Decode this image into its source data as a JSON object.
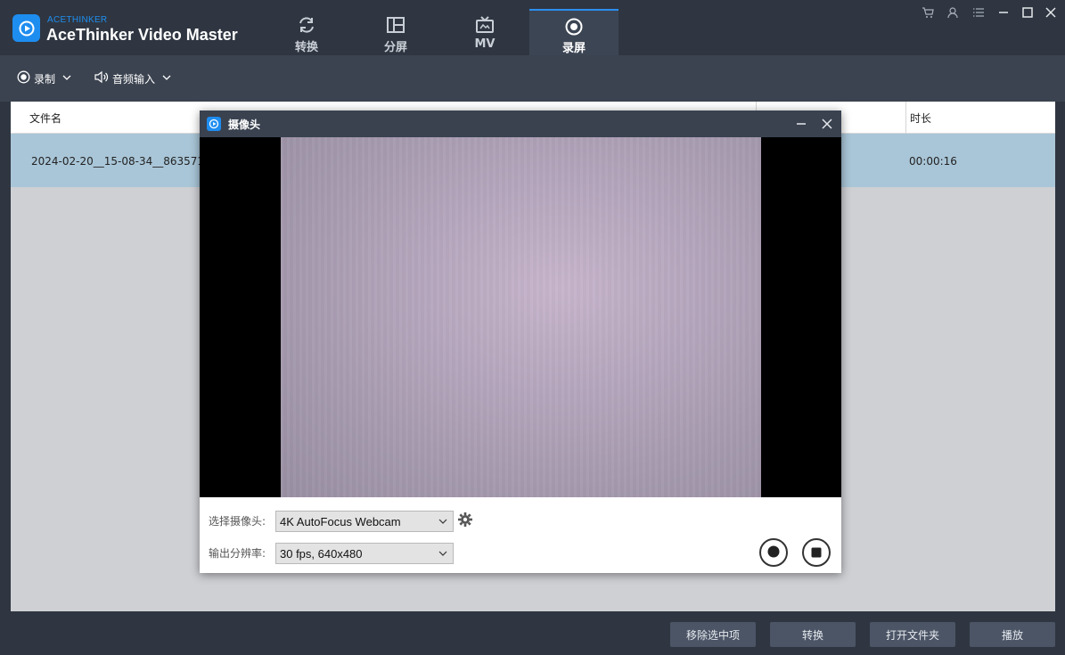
{
  "app": {
    "brand_small": "ACETHINKER",
    "brand_name": "AceThinker Video Master"
  },
  "tabs": [
    {
      "label": "转换",
      "icon": "refresh-icon"
    },
    {
      "label": "分屏",
      "icon": "split-screen-icon"
    },
    {
      "label": "MV",
      "icon": "tv-icon"
    },
    {
      "label": "录屏",
      "icon": "record-icon",
      "active": true
    }
  ],
  "window_controls": [
    "cart-icon",
    "user-icon",
    "menu-icon",
    "minimize-icon",
    "maximize-icon",
    "close-icon"
  ],
  "toolbar": {
    "record_label": "录制",
    "audio_label": "音频输入"
  },
  "table": {
    "columns": [
      "文件名",
      "时长"
    ],
    "rows": [
      {
        "filename": "2024-02-20__15-08-34__8635715",
        "duration": "00:00:16"
      }
    ]
  },
  "bottom": {
    "remove_label": "移除选中项",
    "convert_label": "转换",
    "open_folder_label": "打开文件夹",
    "play_label": "播放"
  },
  "camera_dialog": {
    "title": "摄像头",
    "camera_label": "选择摄像头:",
    "camera_value": "4K AutoFocus Webcam",
    "resolution_label": "输出分辨率:",
    "resolution_value": "30 fps, 640x480"
  },
  "colors": {
    "accent": "#1e8df0",
    "titlebar": "#2f3641",
    "toolbar": "#3b4350",
    "selected_row": "#a9c6d8",
    "button": "#4b5566"
  }
}
